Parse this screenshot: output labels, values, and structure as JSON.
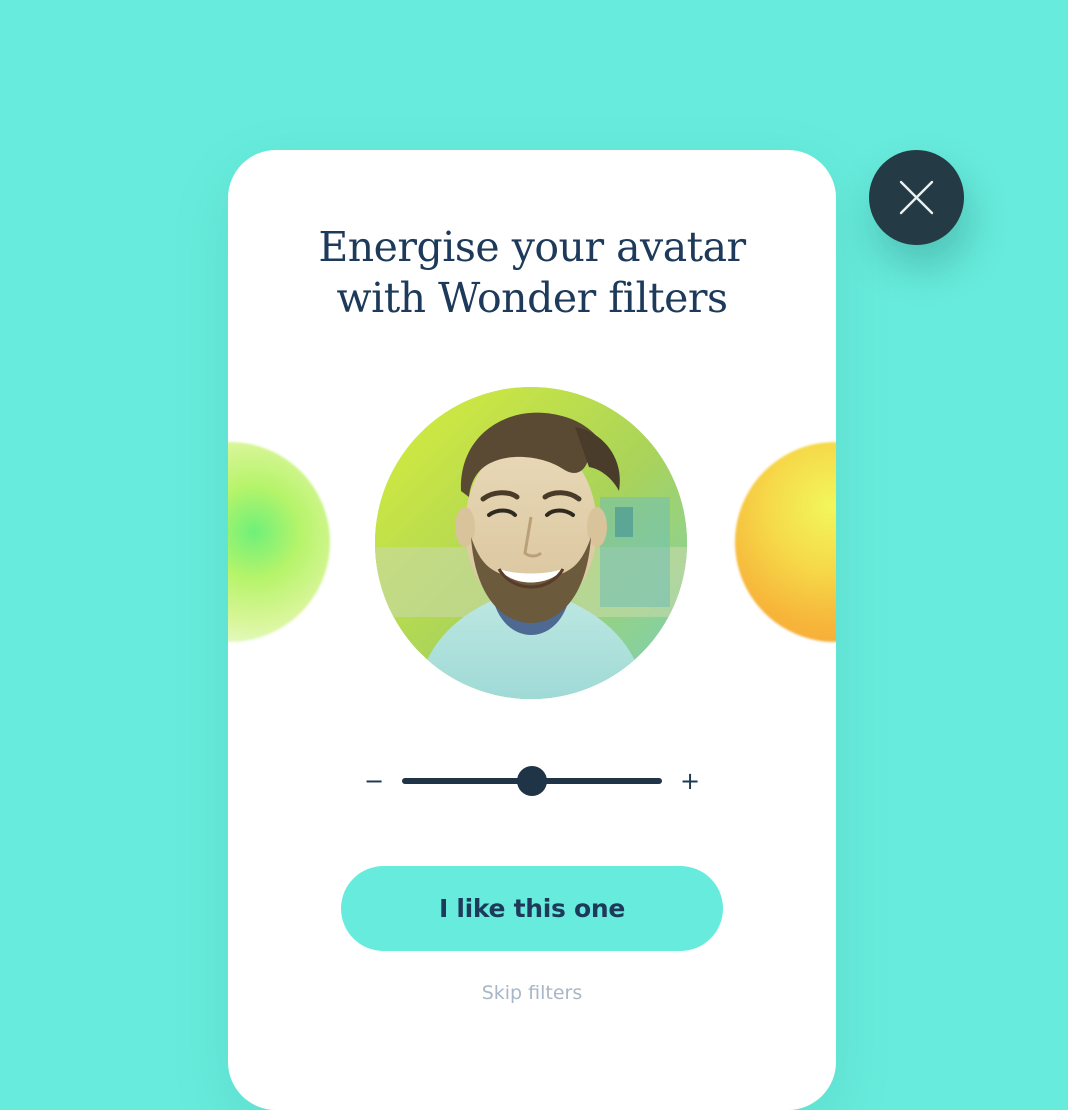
{
  "dialog": {
    "title_line1": "Energise your avatar",
    "title_line2": "with Wonder filters",
    "close_icon": "close-icon",
    "primary_button_label": "I like this one",
    "skip_link_label": "Skip filters"
  },
  "filter_strength": {
    "minus_label": "−",
    "plus_label": "+",
    "value": 0.5
  },
  "colors": {
    "background": "#67ebdc",
    "accent": "#67ebdc",
    "title_text": "#1d3a5a",
    "close_button": "#243a44",
    "skip_text": "#a9b6c6"
  },
  "filters": [
    {
      "name": "prev-filter",
      "color": "#8ef07a"
    },
    {
      "name": "current-filter",
      "color": "#c9e446"
    },
    {
      "name": "next-filter",
      "color": "#f5c842"
    }
  ]
}
